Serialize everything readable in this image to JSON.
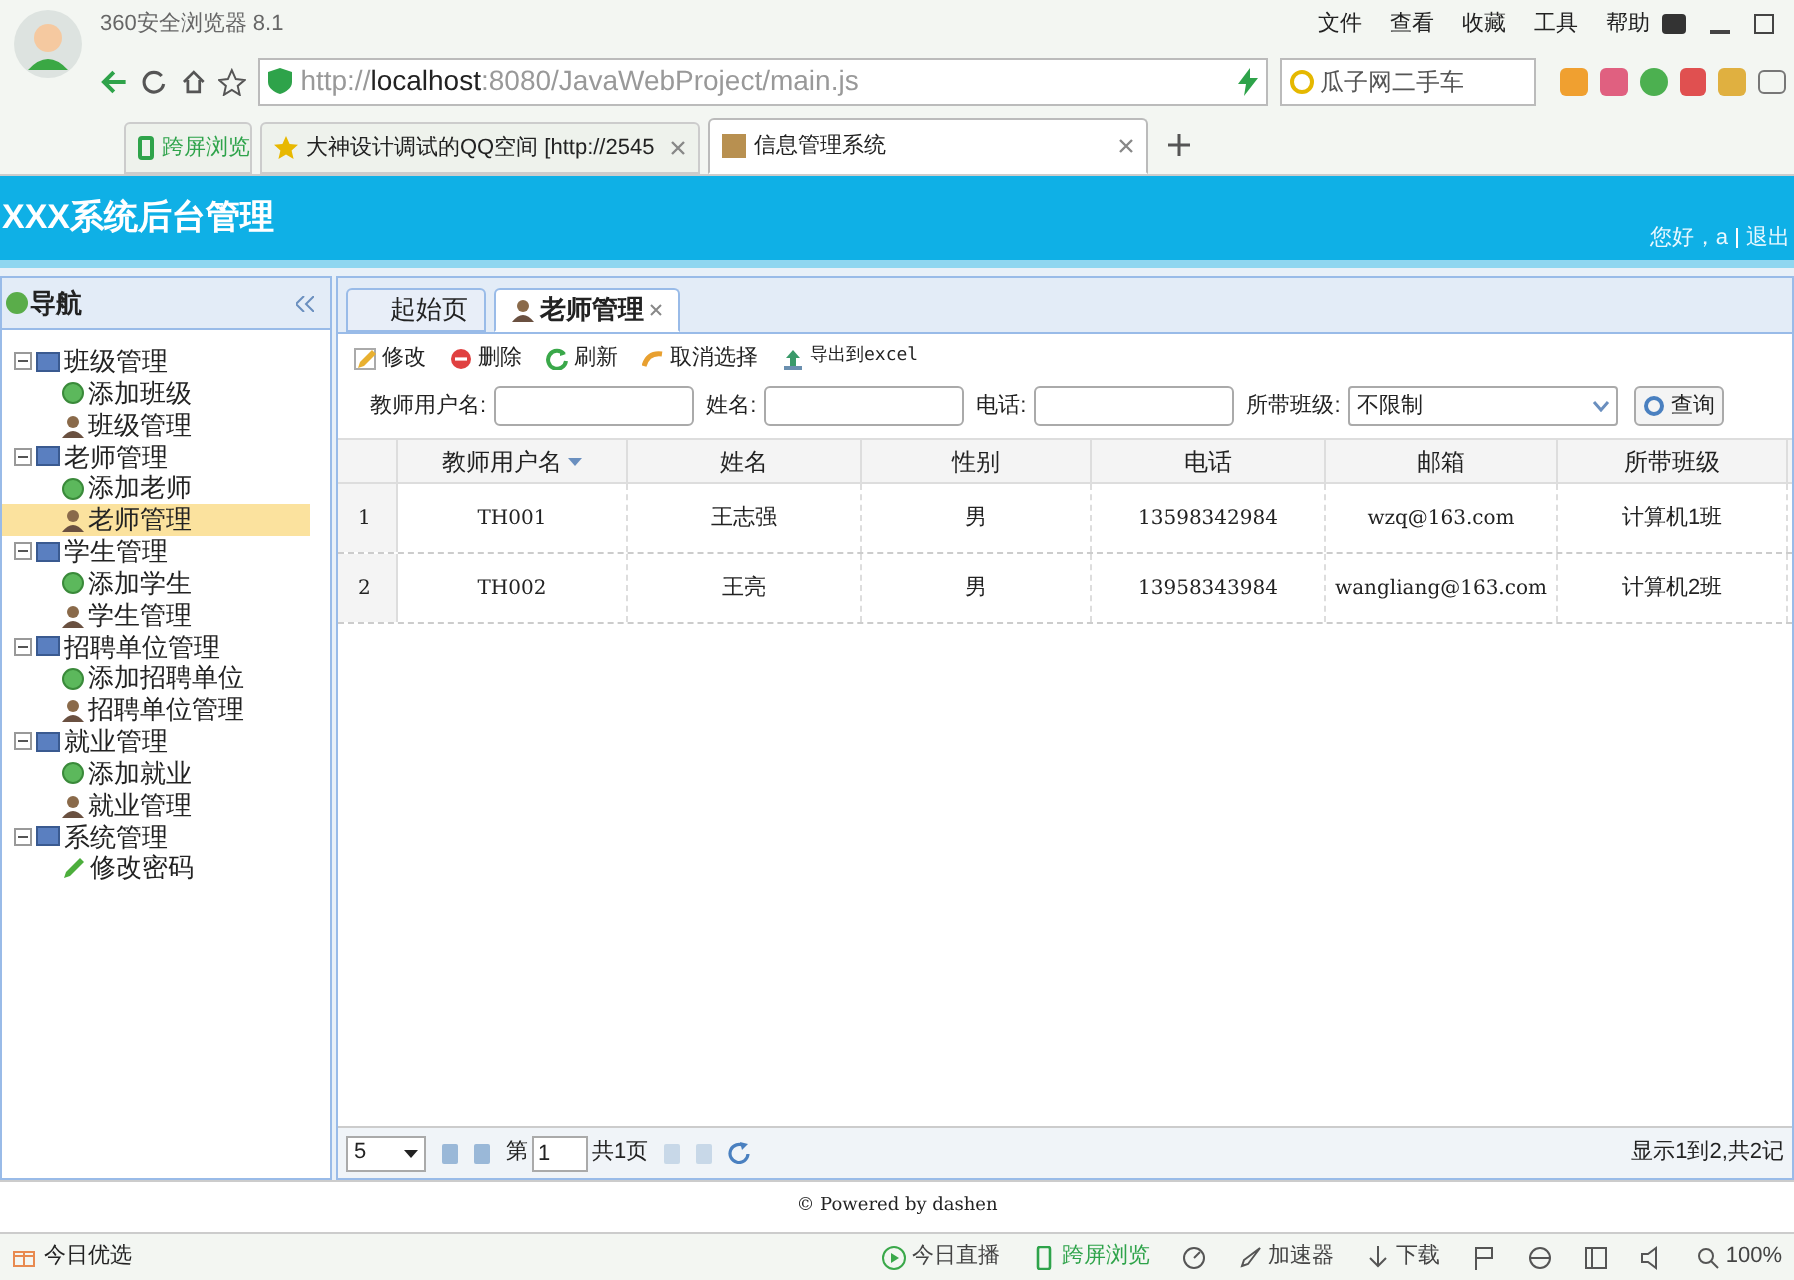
{
  "browser": {
    "title": "360安全浏览器 8.1",
    "menu": [
      "文件",
      "查看",
      "收藏",
      "工具",
      "帮助"
    ],
    "address": {
      "scheme": "http://",
      "host": "localhost",
      "rest": ":8080/JavaWebProject/main.js"
    },
    "search": {
      "value": "瓜子网二手车"
    },
    "tabs": [
      {
        "label": "跨屏浏览",
        "selected": false,
        "kind": "pinned"
      },
      {
        "label": "大神设计调试的QQ空间 [http://2545",
        "selected": false,
        "kind": "page"
      },
      {
        "label": "信息管理系统",
        "selected": true,
        "kind": "page"
      }
    ]
  },
  "app": {
    "title": "XXX系统后台管理",
    "greeting": "您好，a",
    "logout": "退出"
  },
  "nav": {
    "title": "导航",
    "items": [
      {
        "label": "班级管理",
        "expanded": true,
        "children": [
          {
            "label": "添加班级",
            "kind": "add",
            "selected": false
          },
          {
            "label": "班级管理",
            "kind": "user",
            "selected": false
          }
        ]
      },
      {
        "label": "老师管理",
        "expanded": true,
        "children": [
          {
            "label": "添加老师",
            "kind": "add",
            "selected": false
          },
          {
            "label": "老师管理",
            "kind": "user",
            "selected": true
          }
        ]
      },
      {
        "label": "学生管理",
        "expanded": true,
        "children": [
          {
            "label": "添加学生",
            "kind": "add",
            "selected": false
          },
          {
            "label": "学生管理",
            "kind": "user",
            "selected": false
          }
        ]
      },
      {
        "label": "招聘单位管理",
        "expanded": true,
        "children": [
          {
            "label": "添加招聘单位",
            "kind": "add",
            "selected": false
          },
          {
            "label": "招聘单位管理",
            "kind": "user",
            "selected": false
          }
        ]
      },
      {
        "label": "就业管理",
        "expanded": true,
        "children": [
          {
            "label": "添加就业",
            "kind": "add",
            "selected": false
          },
          {
            "label": "就业管理",
            "kind": "user",
            "selected": false
          }
        ]
      },
      {
        "label": "系统管理",
        "expanded": true,
        "children": [
          {
            "label": "修改密码",
            "kind": "edit",
            "selected": false
          }
        ]
      }
    ]
  },
  "content": {
    "tabs": [
      {
        "label": "起始页",
        "selected": false
      },
      {
        "label": "老师管理",
        "selected": true
      }
    ],
    "toolbar": [
      {
        "label": "修改",
        "kind": "edit"
      },
      {
        "label": "删除",
        "kind": "delete"
      },
      {
        "label": "刷新",
        "kind": "refresh"
      },
      {
        "label": "取消选择",
        "kind": "undo"
      },
      {
        "label": "导出到excel",
        "kind": "export"
      }
    ],
    "filters": [
      {
        "label": "教师用户名:",
        "kind": "text"
      },
      {
        "label": "姓名:",
        "kind": "text"
      },
      {
        "label": "电话:",
        "kind": "text"
      },
      {
        "label": "所带班级:",
        "kind": "select",
        "value": "不限制"
      }
    ],
    "search_button": "查询",
    "table": {
      "columns": [
        {
          "label": "教师用户名",
          "sorted": true
        },
        {
          "label": "姓名",
          "sorted": false
        },
        {
          "label": "性别",
          "sorted": false
        },
        {
          "label": "电话",
          "sorted": false
        },
        {
          "label": "邮箱",
          "sorted": false
        },
        {
          "label": "所带班级",
          "sorted": false
        }
      ],
      "rows": [
        {
          "index": "1",
          "cells": [
            "TH001",
            "王志强",
            "男",
            "13598342984",
            "wzq@163.com",
            "计算机1班"
          ]
        },
        {
          "index": "2",
          "cells": [
            "TH002",
            "王亮",
            "男",
            "13958343984",
            "wangliang@163.com",
            "计算机2班"
          ]
        }
      ]
    },
    "pager": {
      "page_size": "5",
      "page_prefix": "第",
      "page": "1",
      "pages": "共1页",
      "summary": "显示1到2,共2记"
    }
  },
  "footer": "© Powered by dashen",
  "status_bar": {
    "left": "今日优选",
    "items": [
      {
        "label": "今日直播",
        "kind": "play"
      },
      {
        "label": "跨屏浏览",
        "kind": "phone"
      },
      {
        "kind": "speed"
      },
      {
        "label": "加速器",
        "kind": "rocket"
      },
      {
        "label": "下载",
        "kind": "download"
      },
      {
        "kind": "flag"
      },
      {
        "kind": "ie"
      },
      {
        "kind": "window"
      },
      {
        "kind": "sound"
      },
      {
        "label": "100%",
        "kind": "zoom"
      }
    ]
  }
}
